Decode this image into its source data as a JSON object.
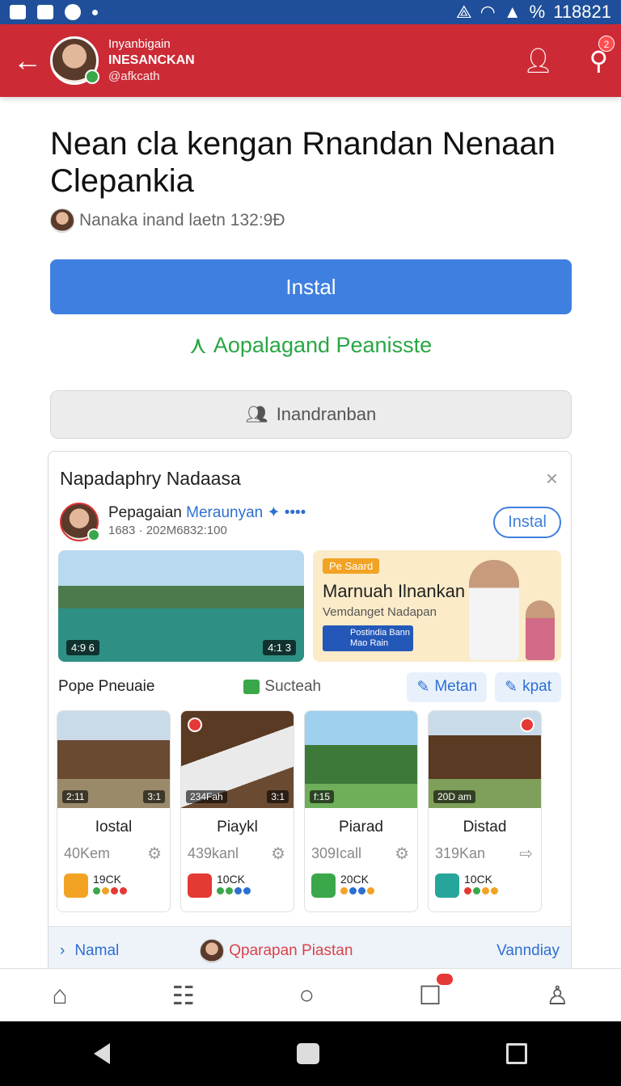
{
  "status_bar": {
    "percent_label": "%",
    "time": "118821"
  },
  "app_bar": {
    "line1": "Inyanbigain",
    "line2": "INESANCKAN",
    "line3": "@afkcath",
    "notif_count": "2"
  },
  "page": {
    "title": "Nean cla kengan Rnandan Nenaan Clepankia",
    "meta": "Nanaka inand laetn 132:9Đ",
    "install_button": "Instal",
    "green_link": "Aopalagand Peanisste",
    "secondary_button": "Inandranban"
  },
  "card": {
    "heading": "Napadaphry Nadaasa",
    "close": "×",
    "post_name": "Pepagaian",
    "post_name_blue": "Meraunyan",
    "post_more": "✦ ••••",
    "post_date": "1683 · 202M6832:100",
    "pill_button": "Instal",
    "media_tag_left": "4:9 6",
    "media_tag_right": "4:1 3",
    "promo_chip": "Pe Saard",
    "promo_headline": "Marnuah Ilnankan",
    "promo_sub": "Vemdanget Nadapan",
    "promo_box": "Postindia Bann Mao Rain",
    "tool_label": "Pope Pneuaie",
    "tool_suc": "Sucteah",
    "chip_1": "Metan",
    "chip_2": "kpat",
    "tiles": [
      {
        "name": "Iostal",
        "size": "40Kem",
        "thumb_left": "2:11",
        "thumb_right": "3:1",
        "count": "19CK",
        "icon_color": "#f2a323"
      },
      {
        "name": "Piaykl",
        "size": "439kanl",
        "thumb_left": "234Fah",
        "thumb_right": "3:1",
        "count": "10CK",
        "icon_color": "#e53935"
      },
      {
        "name": "Piarad",
        "size": "309Icall",
        "thumb_left": "f:15",
        "thumb_right": "",
        "count": "20CK",
        "icon_color": "#3aa84a"
      },
      {
        "name": "Distad",
        "size": "319Kan",
        "thumb_left": "20D am",
        "thumb_right": "",
        "count": "10CK",
        "icon_color": "#26a69a"
      }
    ],
    "footer_left": "Namal",
    "footer_mid": "Qparapan Piastan",
    "footer_right": "Vanndiay"
  },
  "bottom_tabs": [
    "home",
    "feed",
    "circle",
    "inbox",
    "profile"
  ]
}
